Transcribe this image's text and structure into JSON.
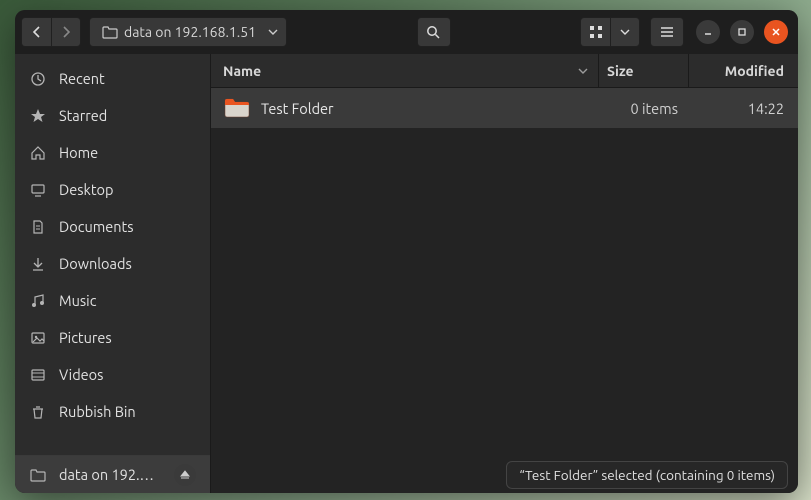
{
  "pathbar": {
    "location": "data on 192.168.1.51"
  },
  "sidebar": {
    "items": [
      {
        "label": "Recent"
      },
      {
        "label": "Starred"
      },
      {
        "label": "Home"
      },
      {
        "label": "Desktop"
      },
      {
        "label": "Documents"
      },
      {
        "label": "Downloads"
      },
      {
        "label": "Music"
      },
      {
        "label": "Pictures"
      },
      {
        "label": "Videos"
      },
      {
        "label": "Rubbish Bin"
      }
    ],
    "mount": {
      "label": "data on 192.…"
    }
  },
  "columns": {
    "name": "Name",
    "size": "Size",
    "modified": "Modified"
  },
  "files": [
    {
      "name": "Test Folder",
      "size": "0 items",
      "modified": "14:22"
    }
  ],
  "status": {
    "text": "“Test Folder” selected  (containing 0 items)"
  }
}
